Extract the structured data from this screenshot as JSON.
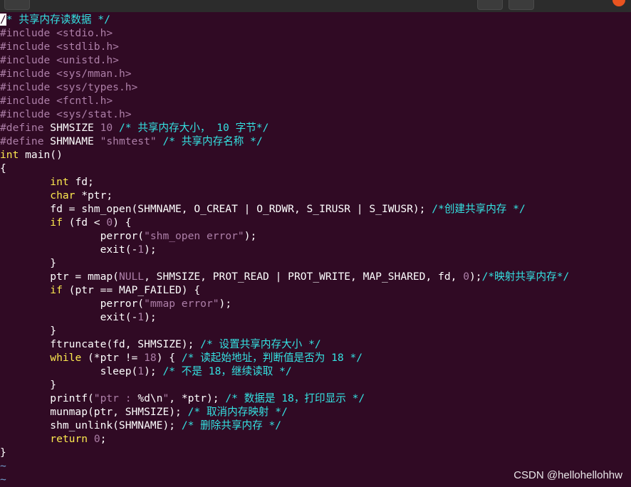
{
  "window": {
    "title_fragment": "·  ·  ·              ·          ·"
  },
  "editor": {
    "lines": [
      {
        "tokens": [
          {
            "t": "/",
            "c": "cursor"
          },
          {
            "t": "* 共享内存读数据 */",
            "c": "cm"
          }
        ]
      },
      {
        "tokens": [
          {
            "t": "#include ",
            "c": "pp"
          },
          {
            "t": "<stdio.h>",
            "c": "str"
          }
        ]
      },
      {
        "tokens": [
          {
            "t": "#include ",
            "c": "pp"
          },
          {
            "t": "<stdlib.h>",
            "c": "str"
          }
        ]
      },
      {
        "tokens": [
          {
            "t": "#include ",
            "c": "pp"
          },
          {
            "t": "<unistd.h>",
            "c": "str"
          }
        ]
      },
      {
        "tokens": [
          {
            "t": "#include ",
            "c": "pp"
          },
          {
            "t": "<sys/mman.h>",
            "c": "str"
          }
        ]
      },
      {
        "tokens": [
          {
            "t": "#include ",
            "c": "pp"
          },
          {
            "t": "<sys/types.h>",
            "c": "str"
          }
        ]
      },
      {
        "tokens": [
          {
            "t": "#include ",
            "c": "pp"
          },
          {
            "t": "<fcntl.h>",
            "c": "str"
          }
        ]
      },
      {
        "tokens": [
          {
            "t": "#include ",
            "c": "pp"
          },
          {
            "t": "<sys/stat.h>",
            "c": "str"
          }
        ]
      },
      {
        "tokens": [
          {
            "t": "#define ",
            "c": "pp"
          },
          {
            "t": "SHMSIZE ",
            "c": ""
          },
          {
            "t": "10",
            "c": "num"
          },
          {
            "t": " /* 共享内存大小， 10 字节*/",
            "c": "cm"
          }
        ]
      },
      {
        "tokens": [
          {
            "t": "#define ",
            "c": "pp"
          },
          {
            "t": "SHMNAME ",
            "c": ""
          },
          {
            "t": "\"shmtest\"",
            "c": "str"
          },
          {
            "t": " /* 共享内存名称 */",
            "c": "cm"
          }
        ]
      },
      {
        "tokens": [
          {
            "t": "int",
            "c": "ty"
          },
          {
            "t": " main()",
            "c": ""
          }
        ]
      },
      {
        "tokens": [
          {
            "t": "{",
            "c": ""
          }
        ]
      },
      {
        "tokens": [
          {
            "t": "        ",
            "c": ""
          },
          {
            "t": "int",
            "c": "ty"
          },
          {
            "t": " fd;",
            "c": ""
          }
        ]
      },
      {
        "tokens": [
          {
            "t": "        ",
            "c": ""
          },
          {
            "t": "char",
            "c": "ty"
          },
          {
            "t": " *ptr;",
            "c": ""
          }
        ]
      },
      {
        "tokens": [
          {
            "t": "        fd = shm_open(SHMNAME, O_CREAT | O_RDWR, S_IRUSR | S_IWUSR); ",
            "c": ""
          },
          {
            "t": "/*创建共享内存 */",
            "c": "cm"
          }
        ]
      },
      {
        "tokens": [
          {
            "t": "        ",
            "c": ""
          },
          {
            "t": "if",
            "c": "ty"
          },
          {
            "t": " (fd < ",
            "c": ""
          },
          {
            "t": "0",
            "c": "num"
          },
          {
            "t": ") {",
            "c": ""
          }
        ]
      },
      {
        "tokens": [
          {
            "t": "                perror(",
            "c": ""
          },
          {
            "t": "\"shm_open error\"",
            "c": "str"
          },
          {
            "t": ");",
            "c": ""
          }
        ]
      },
      {
        "tokens": [
          {
            "t": "                exit(-",
            "c": ""
          },
          {
            "t": "1",
            "c": "num"
          },
          {
            "t": ");",
            "c": ""
          }
        ]
      },
      {
        "tokens": [
          {
            "t": "        }",
            "c": ""
          }
        ]
      },
      {
        "tokens": [
          {
            "t": "        ptr = mmap(",
            "c": ""
          },
          {
            "t": "NULL",
            "c": "num"
          },
          {
            "t": ", SHMSIZE, PROT_READ | PROT_WRITE, MAP_SHARED, fd, ",
            "c": ""
          },
          {
            "t": "0",
            "c": "num"
          },
          {
            "t": ");",
            "c": ""
          },
          {
            "t": "/*映射共享内存*/",
            "c": "cm"
          }
        ]
      },
      {
        "tokens": [
          {
            "t": "        ",
            "c": ""
          },
          {
            "t": "if",
            "c": "ty"
          },
          {
            "t": " (ptr == MAP_FAILED) {",
            "c": ""
          }
        ]
      },
      {
        "tokens": [
          {
            "t": "                perror(",
            "c": ""
          },
          {
            "t": "\"mmap error\"",
            "c": "str"
          },
          {
            "t": ");",
            "c": ""
          }
        ]
      },
      {
        "tokens": [
          {
            "t": "                exit(-",
            "c": ""
          },
          {
            "t": "1",
            "c": "num"
          },
          {
            "t": ");",
            "c": ""
          }
        ]
      },
      {
        "tokens": [
          {
            "t": "        }",
            "c": ""
          }
        ]
      },
      {
        "tokens": [
          {
            "t": "        ftruncate(fd, SHMSIZE); ",
            "c": ""
          },
          {
            "t": "/* 设置共享内存大小 */",
            "c": "cm"
          }
        ]
      },
      {
        "tokens": [
          {
            "t": "        ",
            "c": ""
          },
          {
            "t": "while",
            "c": "ty"
          },
          {
            "t": " (*ptr != ",
            "c": ""
          },
          {
            "t": "18",
            "c": "num"
          },
          {
            "t": ") { ",
            "c": ""
          },
          {
            "t": "/* 读起始地址，判断值是否为 18 */",
            "c": "cm"
          }
        ]
      },
      {
        "tokens": [
          {
            "t": "                sleep(",
            "c": ""
          },
          {
            "t": "1",
            "c": "num"
          },
          {
            "t": "); ",
            "c": ""
          },
          {
            "t": "/* 不是 18，继续读取 */",
            "c": "cm"
          }
        ]
      },
      {
        "tokens": [
          {
            "t": "        }",
            "c": ""
          }
        ]
      },
      {
        "tokens": [
          {
            "t": "        printf(",
            "c": ""
          },
          {
            "t": "\"ptr : ",
            "c": "str"
          },
          {
            "t": "%d\\n",
            "c": ""
          },
          {
            "t": "\"",
            "c": "str"
          },
          {
            "t": ", *ptr); ",
            "c": ""
          },
          {
            "t": "/* 数据是 18，打印显示 */",
            "c": "cm"
          }
        ]
      },
      {
        "tokens": [
          {
            "t": "        munmap(ptr, SHMSIZE); ",
            "c": ""
          },
          {
            "t": "/* 取消内存映射 */",
            "c": "cm"
          }
        ]
      },
      {
        "tokens": [
          {
            "t": "        shm_unlink(SHMNAME); ",
            "c": ""
          },
          {
            "t": "/* 删除共享内存 */",
            "c": "cm"
          }
        ]
      },
      {
        "tokens": [
          {
            "t": "        ",
            "c": ""
          },
          {
            "t": "return",
            "c": "ty"
          },
          {
            "t": " ",
            "c": ""
          },
          {
            "t": "0",
            "c": "num"
          },
          {
            "t": ";",
            "c": ""
          }
        ]
      },
      {
        "tokens": [
          {
            "t": "}",
            "c": ""
          }
        ]
      },
      {
        "tokens": [
          {
            "t": "~",
            "c": "tilde"
          }
        ]
      },
      {
        "tokens": [
          {
            "t": "~",
            "c": "tilde"
          }
        ]
      }
    ]
  },
  "watermark": "CSDN @hellohellohhw",
  "colors": {
    "background": "#300a24",
    "comment": "#34e2e2",
    "preprocessor": "#ad7fa8",
    "keyword": "#fce94f",
    "text": "#ffffff"
  }
}
